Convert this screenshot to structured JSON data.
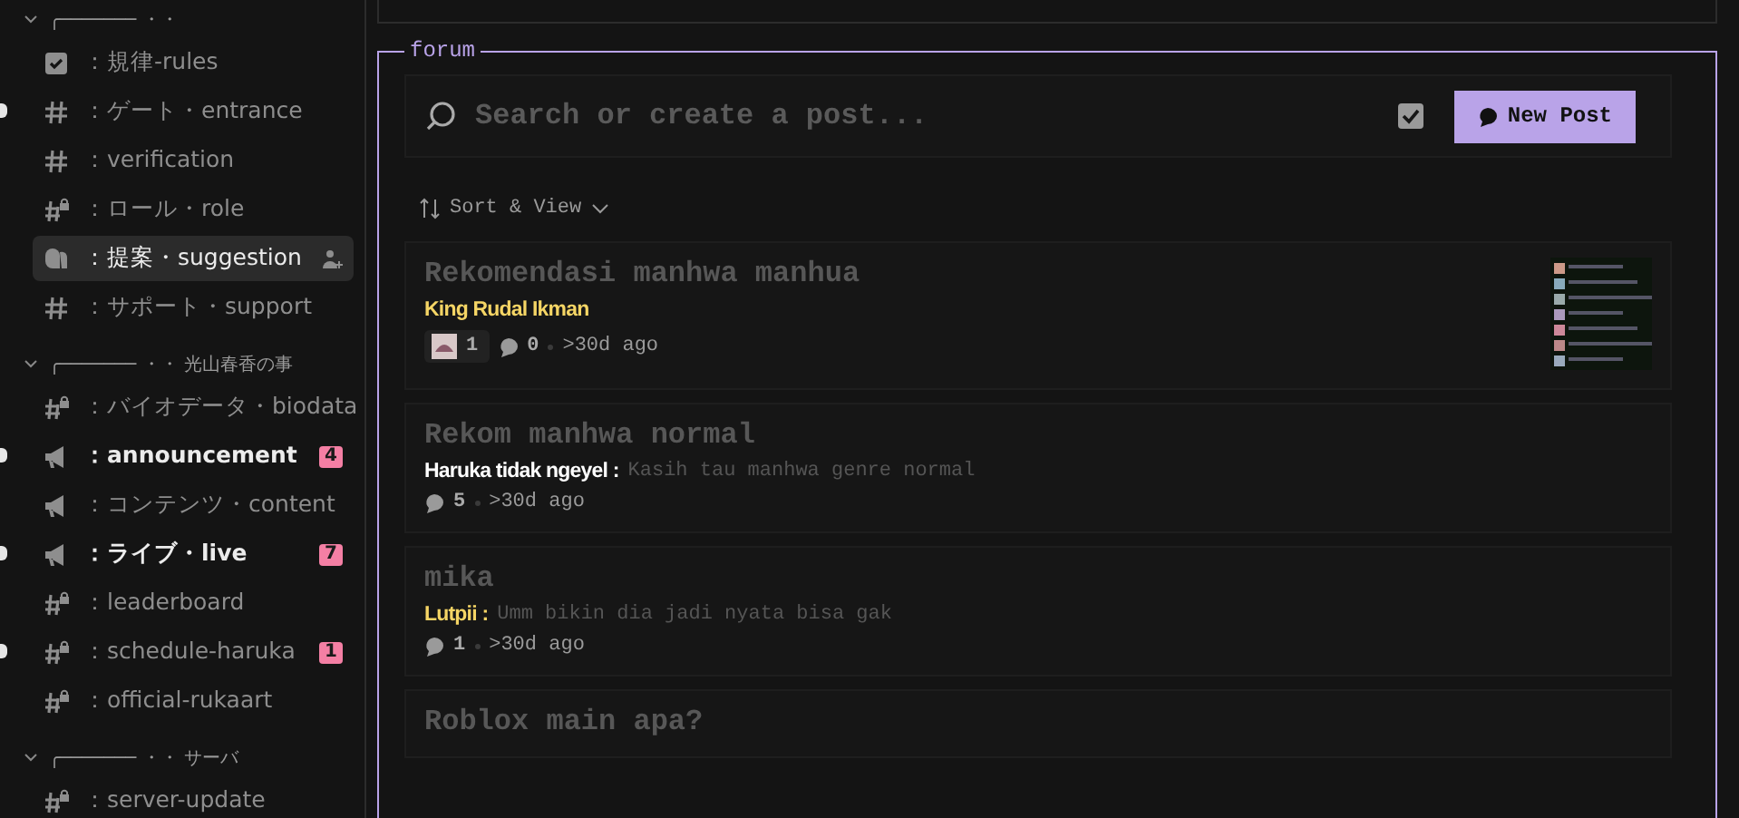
{
  "sidebar": {
    "groups": [
      {
        "header": "╭─────── ・・",
        "expanded": true,
        "items": [
          {
            "kind": "rules",
            "name": "：規律-rules",
            "selected": false,
            "unread": false,
            "highlighted": false
          },
          {
            "kind": "text",
            "name": "：ゲート・entrance",
            "selected": false,
            "unread": true,
            "highlighted": false
          },
          {
            "kind": "text",
            "name": "：verification",
            "selected": false,
            "unread": false,
            "highlighted": false
          },
          {
            "kind": "locked",
            "name": "：ロール・role",
            "selected": false,
            "unread": false,
            "highlighted": false
          },
          {
            "kind": "forum",
            "name": "：提案・suggestion",
            "selected": true,
            "unread": false,
            "highlighted": false
          },
          {
            "kind": "text",
            "name": "：サポート・support",
            "selected": false,
            "unread": false,
            "highlighted": false
          }
        ]
      },
      {
        "header": "╭─────── ・・ 光山春香の事",
        "expanded": true,
        "items": [
          {
            "kind": "locked",
            "name": "：バイオデータ・biodata",
            "selected": false,
            "unread": false,
            "highlighted": false
          },
          {
            "kind": "announcement",
            "name": "：announcement",
            "selected": false,
            "unread": true,
            "highlighted": true,
            "badge": "4"
          },
          {
            "kind": "announcement",
            "name": "：コンテンツ・content",
            "selected": false,
            "unread": false,
            "highlighted": false
          },
          {
            "kind": "announcement",
            "name": "：ライブ・live",
            "selected": false,
            "unread": true,
            "highlighted": true,
            "badge": "7"
          },
          {
            "kind": "locked",
            "name": "：leaderboard",
            "selected": false,
            "unread": false,
            "highlighted": false
          },
          {
            "kind": "locked",
            "name": "：schedule-haruka",
            "selected": false,
            "unread": true,
            "highlighted": false,
            "badge": "1"
          },
          {
            "kind": "locked",
            "name": "：official-rukaart",
            "selected": false,
            "unread": false,
            "highlighted": false
          }
        ]
      },
      {
        "header": "╭─────── ・・ サーバ",
        "expanded": true,
        "items": [
          {
            "kind": "locked",
            "name": "：server-update",
            "selected": false,
            "unread": false,
            "highlighted": false
          }
        ]
      }
    ]
  },
  "forum": {
    "legend": "forum",
    "search": {
      "placeholder": "Search or create a post..."
    },
    "new_post": "New Post",
    "sort": "Sort & View",
    "posts": [
      {
        "title": "Rekomendasi manhwa manhua",
        "author": "King Rudal Ikman",
        "color": "#f5d565",
        "reaction_count": "1",
        "comments": "0",
        "time": ">30d ago",
        "thumbnail": true
      },
      {
        "title": "Rekom manhwa normal",
        "author": "Haruka tidak ngeyel :",
        "color": "#ffffff",
        "snippet": "Kasih tau manhwa genre normal",
        "comments": "5",
        "time": ">30d ago",
        "thumbnail": false
      },
      {
        "title": "mika",
        "author": "Lutpii :",
        "color": "#f5d565",
        "snippet": "Umm bikin dia jadi nyata bisa gak",
        "comments": "1",
        "time": ">30d ago",
        "thumbnail": false
      },
      {
        "title": "Roblox main apa?",
        "thumbnail": false
      }
    ]
  }
}
